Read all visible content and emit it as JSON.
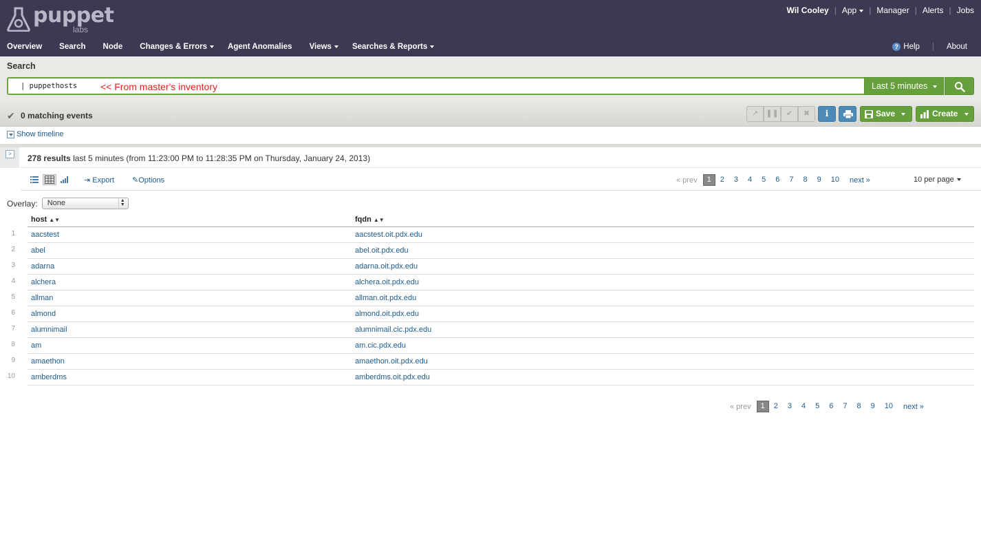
{
  "header": {
    "logo_word": "puppet",
    "logo_sub": "labs",
    "user_nav": [
      "Wil Cooley",
      "App",
      "Manager",
      "Alerts",
      "Jobs"
    ],
    "main_nav": [
      {
        "label": "Overview",
        "dropdown": false
      },
      {
        "label": "Search",
        "dropdown": false
      },
      {
        "label": "Node",
        "dropdown": false
      },
      {
        "label": "Changes & Errors",
        "dropdown": true
      },
      {
        "label": "Agent Anomalies",
        "dropdown": false
      },
      {
        "label": "Views",
        "dropdown": true
      },
      {
        "label": "Searches & Reports",
        "dropdown": true
      }
    ],
    "help_label": "Help",
    "about_label": "About"
  },
  "search": {
    "title": "Search",
    "query": "| puppethosts",
    "annotation": "<< From master's inventory",
    "time_range": "Last 5 minutes"
  },
  "events": {
    "count_label": "0 matching events",
    "save_label": "Save",
    "create_label": "Create"
  },
  "timeline": {
    "label": "Show timeline"
  },
  "results": {
    "count": "278 results",
    "range_text": "last 5 minutes (from 11:23:00 PM to 11:28:35 PM on Thursday, January 24, 2013)",
    "export_label": "Export",
    "options_label": "Options",
    "per_page": "10 per page",
    "pager": {
      "prev": "« prev",
      "current": "1",
      "pages": [
        "2",
        "3",
        "4",
        "5",
        "6",
        "7",
        "8",
        "9",
        "10"
      ],
      "next": "next »"
    }
  },
  "overlay": {
    "label": "Overlay:",
    "value": "None"
  },
  "table": {
    "columns": [
      "host",
      "fqdn"
    ],
    "rows": [
      {
        "n": "1",
        "host": "aacstest",
        "fqdn": "aacstest.oit.pdx.edu"
      },
      {
        "n": "2",
        "host": "abel",
        "fqdn": "abel.oit.pdx.edu"
      },
      {
        "n": "3",
        "host": "adarna",
        "fqdn": "adarna.oit.pdx.edu"
      },
      {
        "n": "4",
        "host": "alchera",
        "fqdn": "alchera.oit.pdx.edu"
      },
      {
        "n": "5",
        "host": "allman",
        "fqdn": "allman.oit.pdx.edu"
      },
      {
        "n": "6",
        "host": "almond",
        "fqdn": "almond.oit.pdx.edu"
      },
      {
        "n": "7",
        "host": "alumnimail",
        "fqdn": "alumnimail.cic.pdx.edu"
      },
      {
        "n": "8",
        "host": "am",
        "fqdn": "am.cic.pdx.edu"
      },
      {
        "n": "9",
        "host": "amaethon",
        "fqdn": "amaethon.oit.pdx.edu"
      },
      {
        "n": "10",
        "host": "amberdms",
        "fqdn": "amberdms.oit.pdx.edu"
      }
    ]
  },
  "colors": {
    "header_bg": "#3c3a52",
    "accent_green": "#66a03c",
    "link_blue": "#1c5b8e",
    "annotation_red": "#e3211c"
  }
}
